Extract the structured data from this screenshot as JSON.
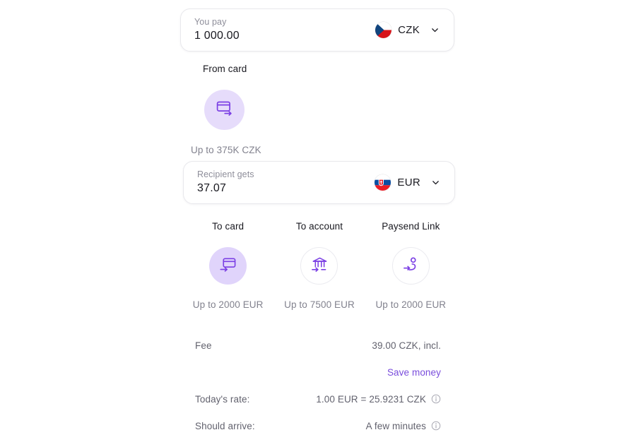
{
  "pay": {
    "label": "You pay",
    "amount": "1 000.00",
    "currency": "CZK",
    "flag": "czech-republic-flag",
    "chevron": "chevron-down-icon"
  },
  "source": {
    "title": "From card",
    "icon": "card-out-icon",
    "limit": "Up to 375K CZK"
  },
  "receive": {
    "label": "Recipient gets",
    "amount": "37.07",
    "currency": "EUR",
    "flag": "slovakia-flag",
    "chevron": "chevron-down-icon"
  },
  "methods": [
    {
      "title": "To card",
      "icon": "card-in-icon",
      "limit": "Up to 2000 EUR",
      "selected": true
    },
    {
      "title": "To account",
      "icon": "bank-in-icon",
      "limit": "Up to 7500 EUR",
      "selected": false
    },
    {
      "title": "Paysend Link",
      "icon": "person-link-icon",
      "limit": "Up to 2000 EUR",
      "selected": false
    }
  ],
  "details": {
    "fee_label": "Fee",
    "fee_value": "39.00 CZK, incl.",
    "save_money": "Save money",
    "rate_label": "Today's rate:",
    "rate_value": "1.00 EUR = 25.9231 CZK",
    "arrive_label": "Should arrive:",
    "arrive_value": "A few minutes",
    "info_icon": "info-icon"
  },
  "colors": {
    "accent": "#7a4ddc",
    "accent_soft": "#e0d4fb",
    "text": "#18181f",
    "muted": "#82828e"
  }
}
